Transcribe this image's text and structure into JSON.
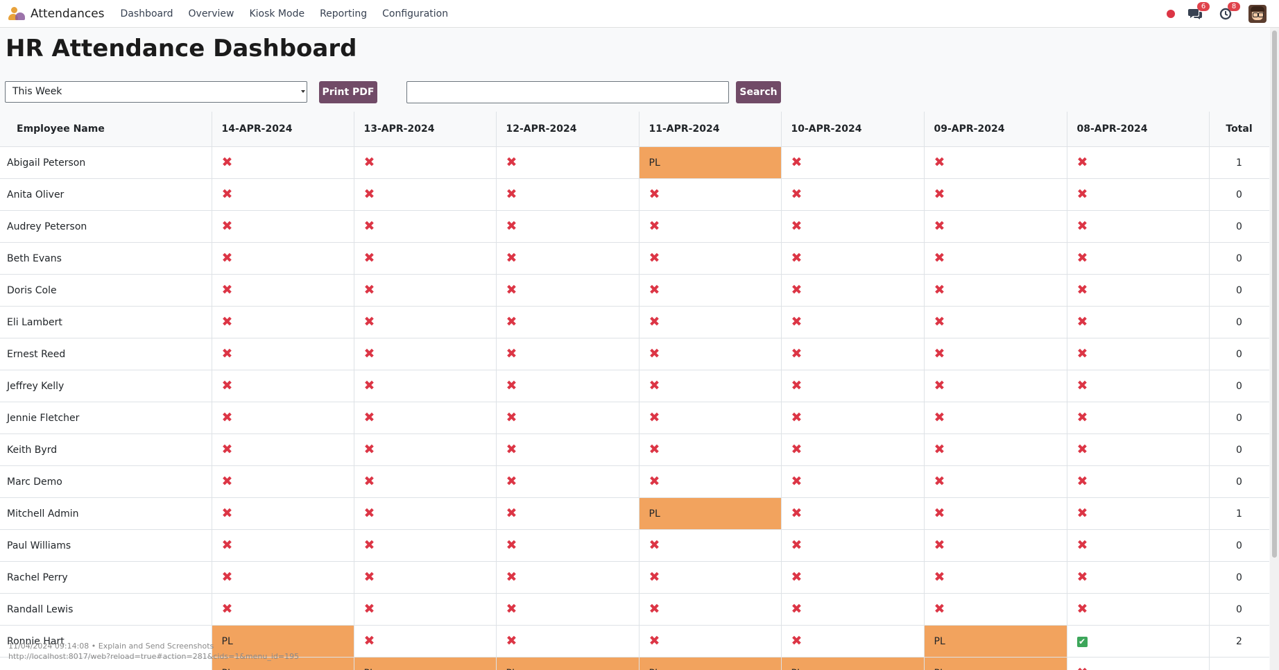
{
  "app": {
    "title": "Attendances"
  },
  "nav": {
    "items": [
      "Dashboard",
      "Overview",
      "Kiosk Mode",
      "Reporting",
      "Configuration"
    ],
    "messages_count": "6",
    "activities_count": "8"
  },
  "page": {
    "title": "HR Attendance Dashboard"
  },
  "controls": {
    "period_value": "This Week",
    "print_label": "Print PDF",
    "search_value": "",
    "search_label": "Search"
  },
  "table": {
    "headers": [
      "Employee Name",
      "14-APR-2024",
      "13-APR-2024",
      "12-APR-2024",
      "11-APR-2024",
      "10-APR-2024",
      "09-APR-2024",
      "08-APR-2024",
      "Total"
    ],
    "absent_symbol": "✖",
    "present_symbol": "✔",
    "rows": [
      {
        "name": "Abigail Peterson",
        "days": [
          "x",
          "x",
          "x",
          "PL",
          "x",
          "x",
          "x"
        ],
        "total": "1"
      },
      {
        "name": "Anita Oliver",
        "days": [
          "x",
          "x",
          "x",
          "x",
          "x",
          "x",
          "x"
        ],
        "total": "0"
      },
      {
        "name": "Audrey Peterson",
        "days": [
          "x",
          "x",
          "x",
          "x",
          "x",
          "x",
          "x"
        ],
        "total": "0"
      },
      {
        "name": "Beth Evans",
        "days": [
          "x",
          "x",
          "x",
          "x",
          "x",
          "x",
          "x"
        ],
        "total": "0"
      },
      {
        "name": "Doris Cole",
        "days": [
          "x",
          "x",
          "x",
          "x",
          "x",
          "x",
          "x"
        ],
        "total": "0"
      },
      {
        "name": "Eli Lambert",
        "days": [
          "x",
          "x",
          "x",
          "x",
          "x",
          "x",
          "x"
        ],
        "total": "0"
      },
      {
        "name": "Ernest Reed",
        "days": [
          "x",
          "x",
          "x",
          "x",
          "x",
          "x",
          "x"
        ],
        "total": "0"
      },
      {
        "name": "Jeffrey Kelly",
        "days": [
          "x",
          "x",
          "x",
          "x",
          "x",
          "x",
          "x"
        ],
        "total": "0"
      },
      {
        "name": "Jennie Fletcher",
        "days": [
          "x",
          "x",
          "x",
          "x",
          "x",
          "x",
          "x"
        ],
        "total": "0"
      },
      {
        "name": "Keith Byrd",
        "days": [
          "x",
          "x",
          "x",
          "x",
          "x",
          "x",
          "x"
        ],
        "total": "0"
      },
      {
        "name": "Marc Demo",
        "days": [
          "x",
          "x",
          "x",
          "x",
          "x",
          "x",
          "x"
        ],
        "total": "0"
      },
      {
        "name": "Mitchell Admin",
        "days": [
          "x",
          "x",
          "x",
          "PL",
          "x",
          "x",
          "x"
        ],
        "total": "1"
      },
      {
        "name": "Paul Williams",
        "days": [
          "x",
          "x",
          "x",
          "x",
          "x",
          "x",
          "x"
        ],
        "total": "0"
      },
      {
        "name": "Rachel Perry",
        "days": [
          "x",
          "x",
          "x",
          "x",
          "x",
          "x",
          "x"
        ],
        "total": "0"
      },
      {
        "name": "Randall Lewis",
        "days": [
          "x",
          "x",
          "x",
          "x",
          "x",
          "x",
          "x"
        ],
        "total": "0"
      },
      {
        "name": "Ronnie Hart",
        "days": [
          "PL",
          "x",
          "x",
          "x",
          "x",
          "PL",
          "check"
        ],
        "total": "2"
      },
      {
        "name": "",
        "days": [
          "PL",
          "PL",
          "PL",
          "PL",
          "PL",
          "PL",
          "x"
        ],
        "total": ""
      }
    ]
  },
  "overlay": {
    "line1": "11/04/2024 09:14:08 • Explain and Send Screenshots",
    "line2": "http://localhost:8017/web?reload=true#action=281&cids=1&menu_id=195"
  },
  "colors": {
    "brand_purple": "#714b67",
    "paid_leave": "#f2a35e",
    "absent": "#dc3545",
    "present": "#3ca65a"
  }
}
